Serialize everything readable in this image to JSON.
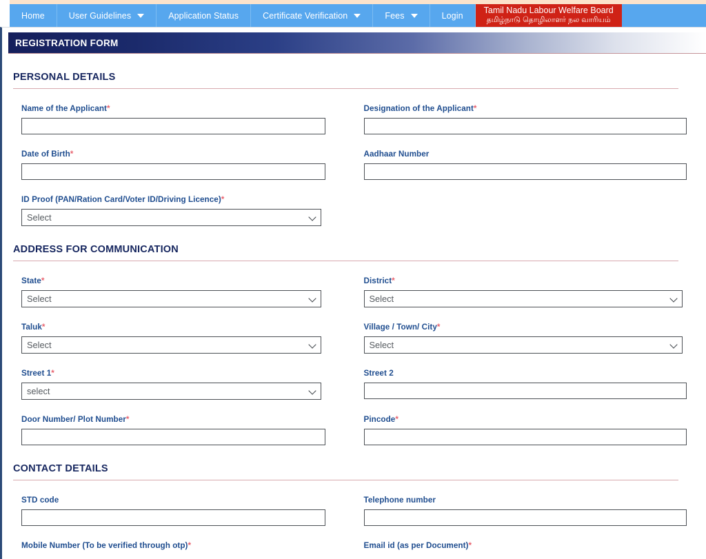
{
  "navbar": {
    "items": [
      {
        "label": "Home",
        "has_caret": false
      },
      {
        "label": "User Guidelines",
        "has_caret": true
      },
      {
        "label": "Application Status",
        "has_caret": false
      },
      {
        "label": "Certificate Verification",
        "has_caret": true
      },
      {
        "label": "Fees",
        "has_caret": true
      },
      {
        "label": "Login",
        "has_caret": false
      }
    ],
    "brand": {
      "english": "Tamil Nadu Labour Welfare Board",
      "tamil": "தமிழ்நாடு தொழிலாளர் நல வாரியம்"
    },
    "colors": {
      "bar": "#57a7ee",
      "brand": "#cf2216",
      "text": "#ffffff"
    }
  },
  "form_header": {
    "title": "REGISTRATION FORM",
    "gradient_from": "#151f5c",
    "gradient_to": "#ffffff"
  },
  "sections": {
    "personal": {
      "title": "PERSONAL DETAILS",
      "fields": {
        "name": {
          "label": "Name of the Applicant",
          "required": true,
          "value": "",
          "type": "text"
        },
        "designation": {
          "label": "Designation of the Applicant",
          "required": true,
          "value": "",
          "type": "text"
        },
        "dob": {
          "label": "Date of Birth",
          "required": true,
          "value": "",
          "type": "text"
        },
        "aadhaar": {
          "label": "Aadhaar Number",
          "required": false,
          "value": "",
          "type": "text"
        },
        "id_proof": {
          "label": "ID Proof (PAN/Ration Card/Voter ID/Driving Licence)",
          "required": true,
          "value": "Select",
          "type": "select"
        }
      }
    },
    "address": {
      "title": "ADDRESS FOR COMMUNICATION",
      "fields": {
        "state": {
          "label": "State",
          "required": true,
          "value": "Select",
          "type": "select"
        },
        "district": {
          "label": "District",
          "required": true,
          "value": "Select",
          "type": "select"
        },
        "taluk": {
          "label": "Taluk",
          "required": true,
          "value": "Select",
          "type": "select"
        },
        "village": {
          "label": "Village / Town/ City",
          "required": true,
          "value": "Select",
          "type": "select"
        },
        "street1": {
          "label": "Street 1",
          "required": true,
          "value": "select",
          "type": "select"
        },
        "street2": {
          "label": "Street 2",
          "required": false,
          "value": "",
          "type": "text"
        },
        "door_number": {
          "label": "Door Number/ Plot Number",
          "required": true,
          "value": "",
          "type": "text"
        },
        "pincode": {
          "label": "Pincode",
          "required": true,
          "value": "",
          "type": "text"
        }
      }
    },
    "contact": {
      "title": "CONTACT DETAILS",
      "fields": {
        "std_code": {
          "label": "STD code",
          "required": false,
          "value": "",
          "type": "text"
        },
        "telephone": {
          "label": "Telephone number",
          "required": false,
          "value": "",
          "type": "text"
        },
        "mobile": {
          "label": "Mobile Number (To be verified through otp)",
          "required": true,
          "value": "",
          "type": "text"
        },
        "email": {
          "label": "Email id (as per Document)",
          "required": true,
          "value": "",
          "type": "text"
        }
      }
    }
  },
  "colors": {
    "label": "#1f4d8f",
    "required_asterisk": "#e8636f",
    "section_title": "#15255e",
    "section_rule": "#d7a9ae",
    "input_border": "#4b4f54",
    "frame_border": "#2c4a78"
  }
}
